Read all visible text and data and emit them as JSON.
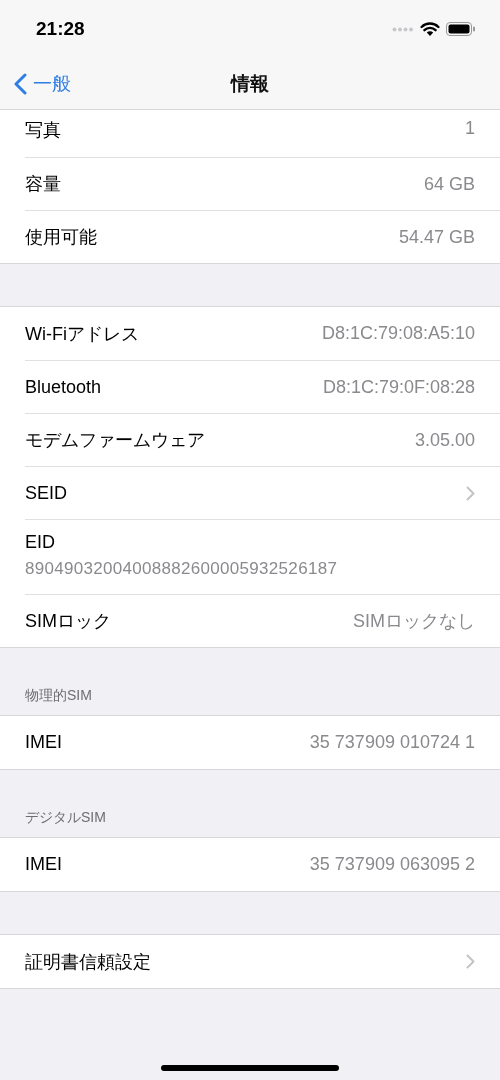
{
  "status_bar": {
    "time": "21:28"
  },
  "nav_bar": {
    "back_label": "一般",
    "title": "情報"
  },
  "sections": [
    {
      "rows": [
        {
          "kind": "value",
          "label": "写真",
          "value": "1"
        },
        {
          "kind": "value",
          "label": "容量",
          "value": "64 GB"
        },
        {
          "kind": "value",
          "label": "使用可能",
          "value": "54.47 GB"
        }
      ]
    },
    {
      "rows": [
        {
          "kind": "value",
          "label": "Wi-Fiアドレス",
          "value": "D8:1C:79:08:A5:10"
        },
        {
          "kind": "value",
          "label": "Bluetooth",
          "value": "D8:1C:79:0F:08:28"
        },
        {
          "kind": "value",
          "label": "モデムファームウェア",
          "value": "3.05.00"
        },
        {
          "kind": "chevron",
          "label": "SEID"
        },
        {
          "kind": "stacked",
          "label": "EID",
          "value": "89049032004008882600005932526187"
        },
        {
          "kind": "value",
          "label": "SIMロック",
          "value": "SIMロックなし"
        }
      ]
    },
    {
      "header": "物理的SIM",
      "rows": [
        {
          "kind": "value",
          "label": "IMEI",
          "value": "35 737909 010724 1"
        }
      ]
    },
    {
      "header": "デジタルSIM",
      "rows": [
        {
          "kind": "value",
          "label": "IMEI",
          "value": "35 737909 063095 2"
        }
      ]
    },
    {
      "rows": [
        {
          "kind": "chevron",
          "label": "証明書信頼設定"
        }
      ]
    }
  ]
}
